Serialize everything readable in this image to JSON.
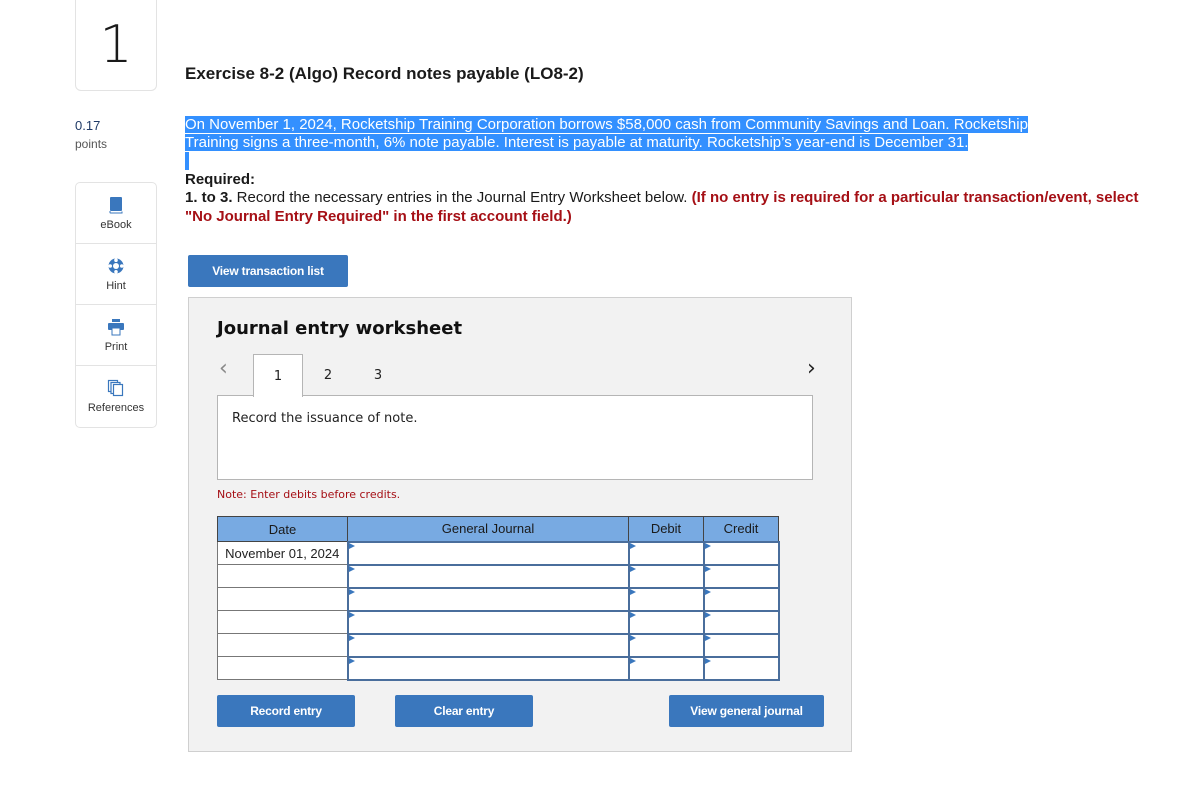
{
  "question": {
    "number": "1",
    "points_value": "0.17",
    "points_label": "points"
  },
  "tools": [
    {
      "label": "eBook",
      "icon": "book-icon"
    },
    {
      "label": "Hint",
      "icon": "lifebuoy-icon"
    },
    {
      "label": "Print",
      "icon": "printer-icon"
    },
    {
      "label": "References",
      "icon": "copy-icon"
    }
  ],
  "exercise": {
    "title": "Exercise 8-2 (Algo) Record notes payable (LO8-2)",
    "intro_line1": "On November 1, 2024, Rocketship Training Corporation borrows $58,000 cash from Community Savings and Loan. Rocketship",
    "intro_line2": "Training signs a three-month, 6% note payable. Interest is payable at maturity. Rocketship’s year-end is December 31.",
    "required_label": "Required:",
    "required_prefix": "1. to 3.",
    "required_text": " Record the necessary entries in the Journal Entry Worksheet below. ",
    "required_emphasis": "(If no entry is required for a particular transaction/event, select \"No Journal Entry Required\" in the first account field.)"
  },
  "buttons": {
    "view_transaction_list": "View transaction list",
    "record_entry": "Record entry",
    "clear_entry": "Clear entry",
    "view_general_journal": "View general journal"
  },
  "worksheet": {
    "title": "Journal entry worksheet",
    "prev_icon": "‹",
    "next_icon": "›",
    "tabs": [
      "1",
      "2",
      "3"
    ],
    "active_tab": "1",
    "description": "Record the issuance of note.",
    "note": "Note: Enter debits before credits.",
    "columns": [
      "Date",
      "General Journal",
      "Debit",
      "Credit"
    ],
    "rows": [
      {
        "date": "November 01, 2024",
        "account": "",
        "debit": "",
        "credit": ""
      },
      {
        "date": "",
        "account": "",
        "debit": "",
        "credit": ""
      },
      {
        "date": "",
        "account": "",
        "debit": "",
        "credit": ""
      },
      {
        "date": "",
        "account": "",
        "debit": "",
        "credit": ""
      },
      {
        "date": "",
        "account": "",
        "debit": "",
        "credit": ""
      },
      {
        "date": "",
        "account": "",
        "debit": "",
        "credit": ""
      }
    ]
  },
  "colors": {
    "accent_button": "#3a77bd",
    "table_header": "#78aae2",
    "warning_red": "#a50f15",
    "selection_highlight": "#3390ff"
  }
}
